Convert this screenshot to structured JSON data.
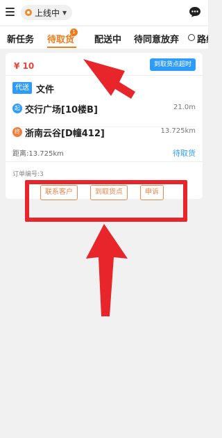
{
  "header": {
    "status_label": "上线中"
  },
  "tabs": [
    {
      "label": "新任务",
      "active": false
    },
    {
      "label": "待取货",
      "active": true,
      "badge": "1"
    },
    {
      "label": "配送中",
      "active": false
    },
    {
      "label": "待同意放弃",
      "active": false
    },
    {
      "label": "路线",
      "active": false
    }
  ],
  "order": {
    "price": "¥ 10",
    "timeout_badge": "到取货点超时",
    "type_tag": "代送",
    "type_text": "文件",
    "pickup": {
      "icon_text": "起",
      "name": "交行广场[10楼B]",
      "distance": "21.0m"
    },
    "dropoff": {
      "icon_text": "终",
      "name": "浙南云谷[D幢412]",
      "distance": "13.725km"
    },
    "distance_text": "距离:13.725km",
    "status_text": "待取货",
    "order_no": "订单编号:3",
    "actions": [
      "联系客户",
      "到取货点",
      "申诉"
    ]
  },
  "colors": {
    "accent": "#f07c1c",
    "blue": "#2e9bff",
    "annotation_red": "#e8252a"
  },
  "icons": [
    "menu-icon",
    "status-dot-icon",
    "caret-down-icon",
    "chat-icon",
    "route-icon"
  ]
}
